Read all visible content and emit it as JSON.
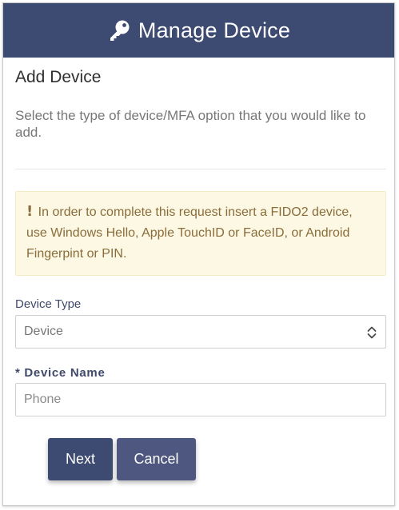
{
  "header": {
    "title": "Manage Device",
    "icon": "key-icon"
  },
  "page": {
    "heading": "Add Device",
    "intro": "Select the type of device/MFA option that you would like to add."
  },
  "alert": {
    "icon": "!",
    "text": "In order to complete this request insert a FIDO2 device, use Windows Hello, Apple TouchID or FaceID, or Android Fingerpint or PIN."
  },
  "form": {
    "device_type": {
      "label": "Device Type",
      "selected": "Device"
    },
    "device_name": {
      "label": "* Device Name",
      "placeholder": "Phone",
      "value": ""
    }
  },
  "buttons": {
    "next": "Next",
    "cancel": "Cancel"
  },
  "colors": {
    "header_bg": "#3d4a72",
    "alert_bg": "#fcf8e3",
    "alert_text": "#8a6d3b",
    "button_primary": "#3d4a72",
    "button_secondary": "#4e5780"
  }
}
